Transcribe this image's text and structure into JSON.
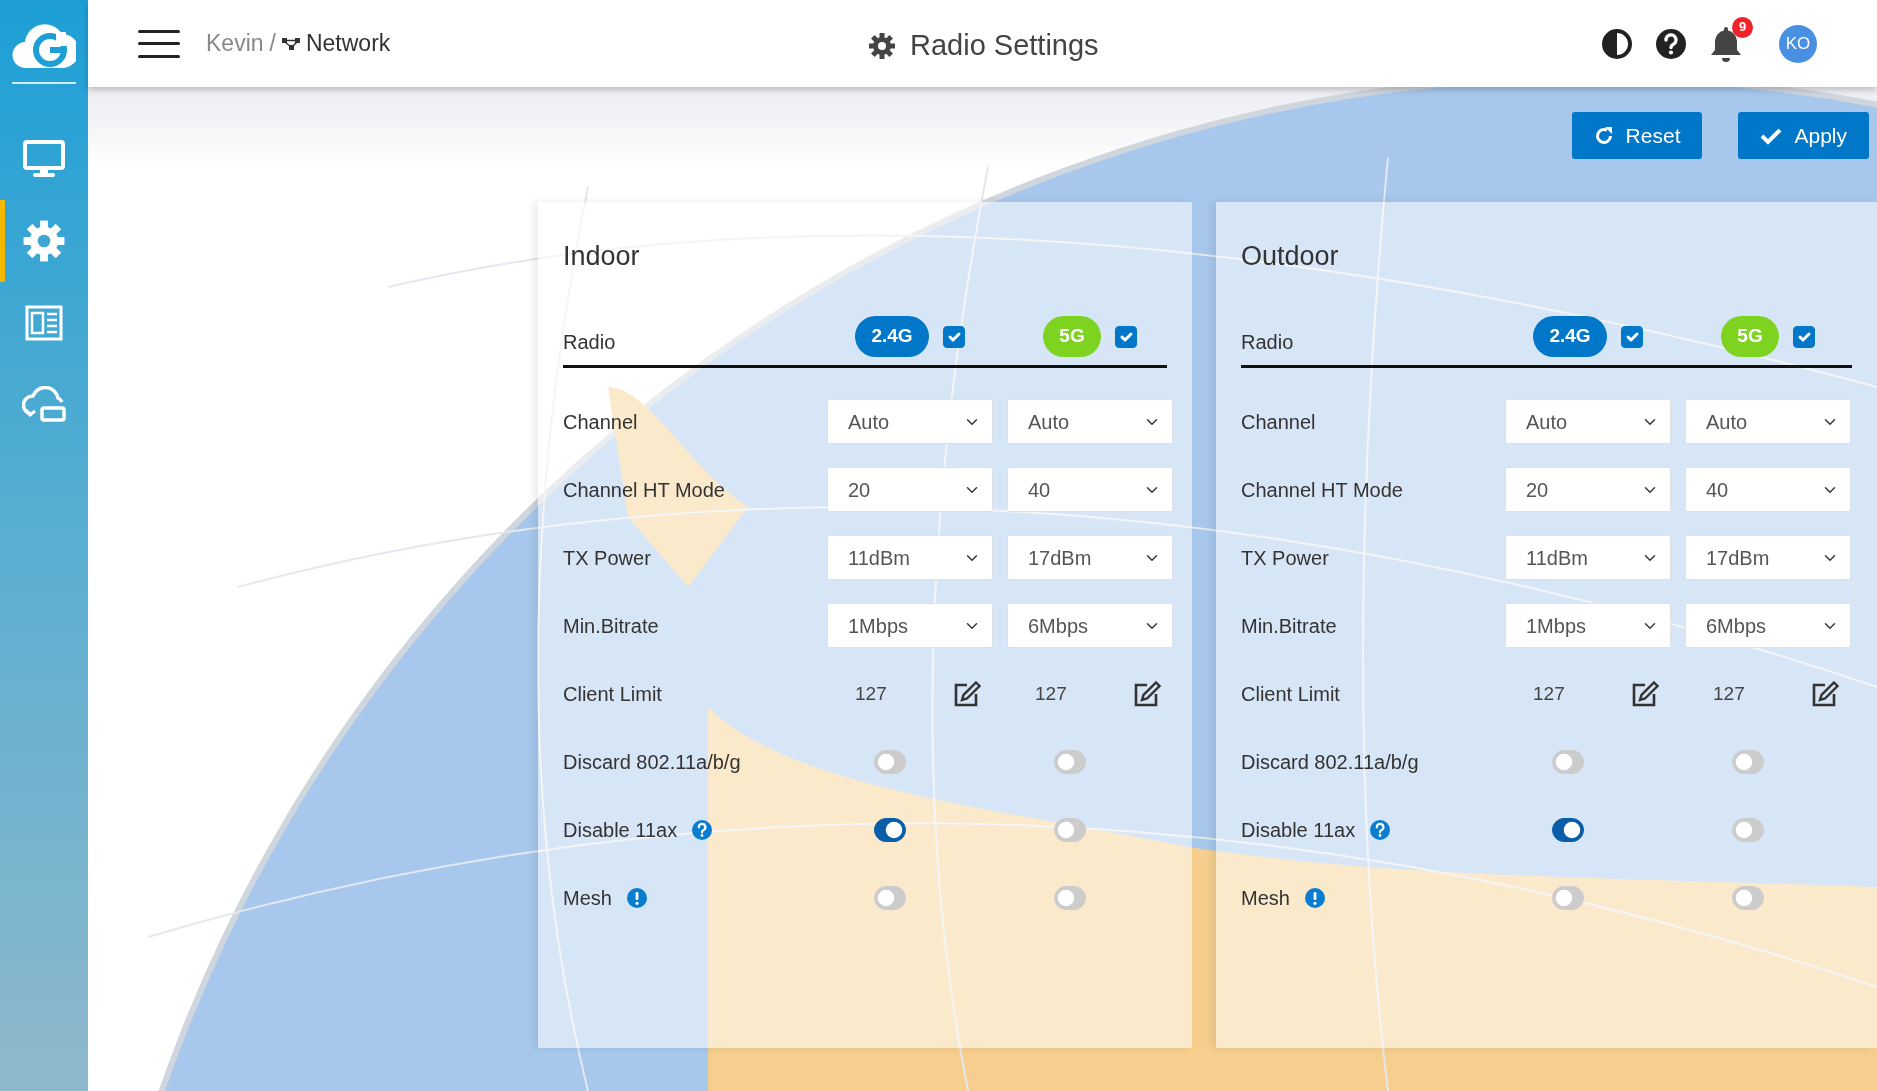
{
  "sidebar": {
    "items": [
      {
        "kind": "monitor",
        "selected": false
      },
      {
        "kind": "gear",
        "selected": true
      },
      {
        "kind": "newspaper",
        "selected": false
      },
      {
        "kind": "cloud",
        "selected": false
      }
    ]
  },
  "header": {
    "breadcrumb": {
      "parent": "Kevin",
      "separator": "/",
      "current": "Network"
    },
    "title": "Radio Settings",
    "notifications": "9",
    "avatar": "KO"
  },
  "actions": [
    {
      "kind": "reset",
      "label": "Reset"
    },
    {
      "kind": "apply",
      "label": "Apply"
    }
  ],
  "panels": [
    {
      "title": "Indoor",
      "radio_label": "Radio",
      "bands": [
        {
          "label": "2.4G",
          "color": "#0077c8",
          "checked": true
        },
        {
          "label": "5G",
          "color": "#7ed321",
          "checked": true
        }
      ],
      "rows": [
        {
          "kind": "select",
          "label": "Channel",
          "values": [
            "Auto",
            "Auto"
          ]
        },
        {
          "kind": "select",
          "label": "Channel HT Mode",
          "values": [
            "20",
            "40"
          ]
        },
        {
          "kind": "select",
          "label": "TX Power",
          "values": [
            "11dBm",
            "17dBm"
          ]
        },
        {
          "kind": "select",
          "label": "Min.Bitrate",
          "values": [
            "1Mbps",
            "6Mbps"
          ]
        },
        {
          "kind": "number",
          "label": "Client Limit",
          "values": [
            "127",
            "127"
          ]
        },
        {
          "kind": "toggle",
          "label": "Discard 802.11a/b/g",
          "toggles": [
            {
              "on": false
            },
            {
              "on": false
            }
          ]
        },
        {
          "kind": "toggle",
          "label": "Disable 11ax",
          "help": true,
          "toggles": [
            {
              "on": true
            },
            {
              "on": false
            }
          ]
        },
        {
          "kind": "toggle",
          "label": "Mesh",
          "alert": true,
          "toggles": [
            {
              "on": false
            },
            {
              "on": false
            }
          ]
        }
      ]
    },
    {
      "title": "Outdoor",
      "radio_label": "Radio",
      "bands": [
        {
          "label": "2.4G",
          "color": "#0077c8",
          "checked": true
        },
        {
          "label": "5G",
          "color": "#7ed321",
          "checked": true
        }
      ],
      "rows": [
        {
          "kind": "select",
          "label": "Channel",
          "values": [
            "Auto",
            "Auto"
          ]
        },
        {
          "kind": "select",
          "label": "Channel HT Mode",
          "values": [
            "20",
            "40"
          ]
        },
        {
          "kind": "select",
          "label": "TX Power",
          "values": [
            "11dBm",
            "17dBm"
          ]
        },
        {
          "kind": "select",
          "label": "Min.Bitrate",
          "values": [
            "1Mbps",
            "6Mbps"
          ]
        },
        {
          "kind": "number",
          "label": "Client Limit",
          "values": [
            "127",
            "127"
          ]
        },
        {
          "kind": "toggle",
          "label": "Discard 802.11a/b/g",
          "toggles": [
            {
              "on": false
            },
            {
              "on": false
            }
          ]
        },
        {
          "kind": "toggle",
          "label": "Disable 11ax",
          "help": true,
          "toggles": [
            {
              "on": true
            },
            {
              "on": false
            }
          ]
        },
        {
          "kind": "toggle",
          "label": "Mesh",
          "alert": true,
          "toggles": [
            {
              "on": false
            },
            {
              "on": false
            }
          ]
        }
      ]
    }
  ]
}
